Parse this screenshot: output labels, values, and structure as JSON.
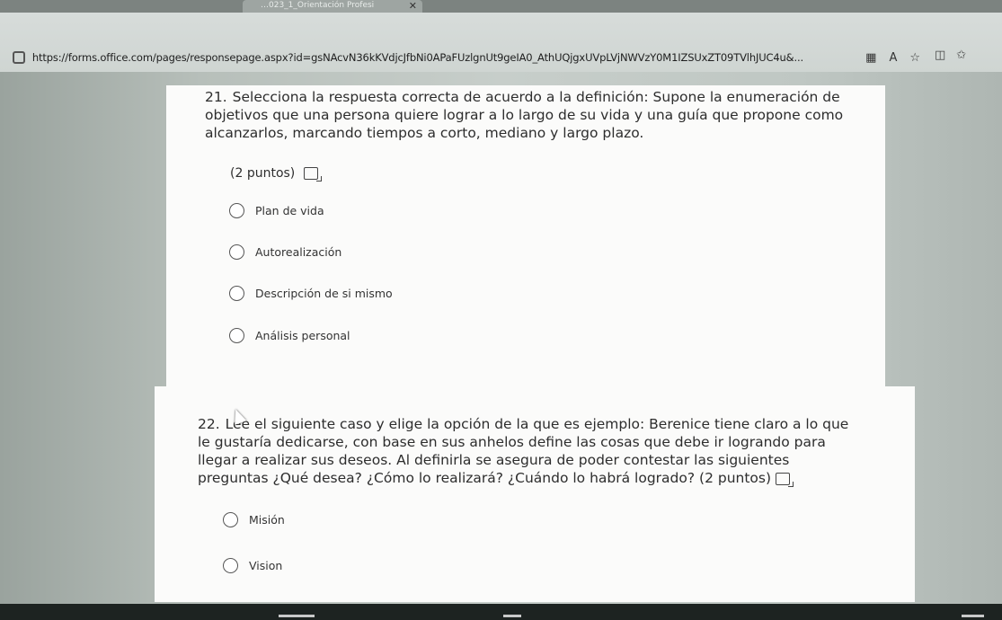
{
  "browser": {
    "tab_title": "…023_1_Orientación Profesi",
    "tab_close": "✕",
    "url": "https://forms.office.com/pages/responsepage.aspx?id=gsNAcvN36kKVdjcJfbNi0APaFUzlgnUt9geIA0_AthUQjgxUVpLVjNWVzY0M1IZSUxZT09TVlhJUC4u&...",
    "icons": [
      "reader-view-icon",
      "read-aloud-icon",
      "favorite-star-icon",
      "split-view-icon",
      "favorites-bar-icon"
    ]
  },
  "questions": [
    {
      "number": "21.",
      "text": "Selecciona la respuesta correcta de acuerdo a la definición: Supone la enumeración de objetivos que una persona quiere lograr a lo largo de su vida y una guía que propone como alcanzarlos, marcando tiempos a corto, mediano y largo plazo.",
      "points": "(2 puntos)",
      "options": [
        "Plan de vida",
        "Autorealización",
        "Descripción de si mismo",
        "Análisis personal"
      ]
    },
    {
      "number": "22.",
      "text": "Lee el siguiente caso y elige la opción de la que es ejemplo: Berenice tiene claro a lo que le gustaría dedicarse, con base en sus anhelos define las cosas que debe ir logrando para llegar a realizar sus deseos. Al definirla se asegura de poder contestar las siguientes preguntas ¿Qué desea? ¿Cómo lo realizará? ¿Cuándo lo habrá logrado?",
      "points": "(2 puntos)",
      "options": [
        "Misión",
        "Vision"
      ]
    }
  ]
}
